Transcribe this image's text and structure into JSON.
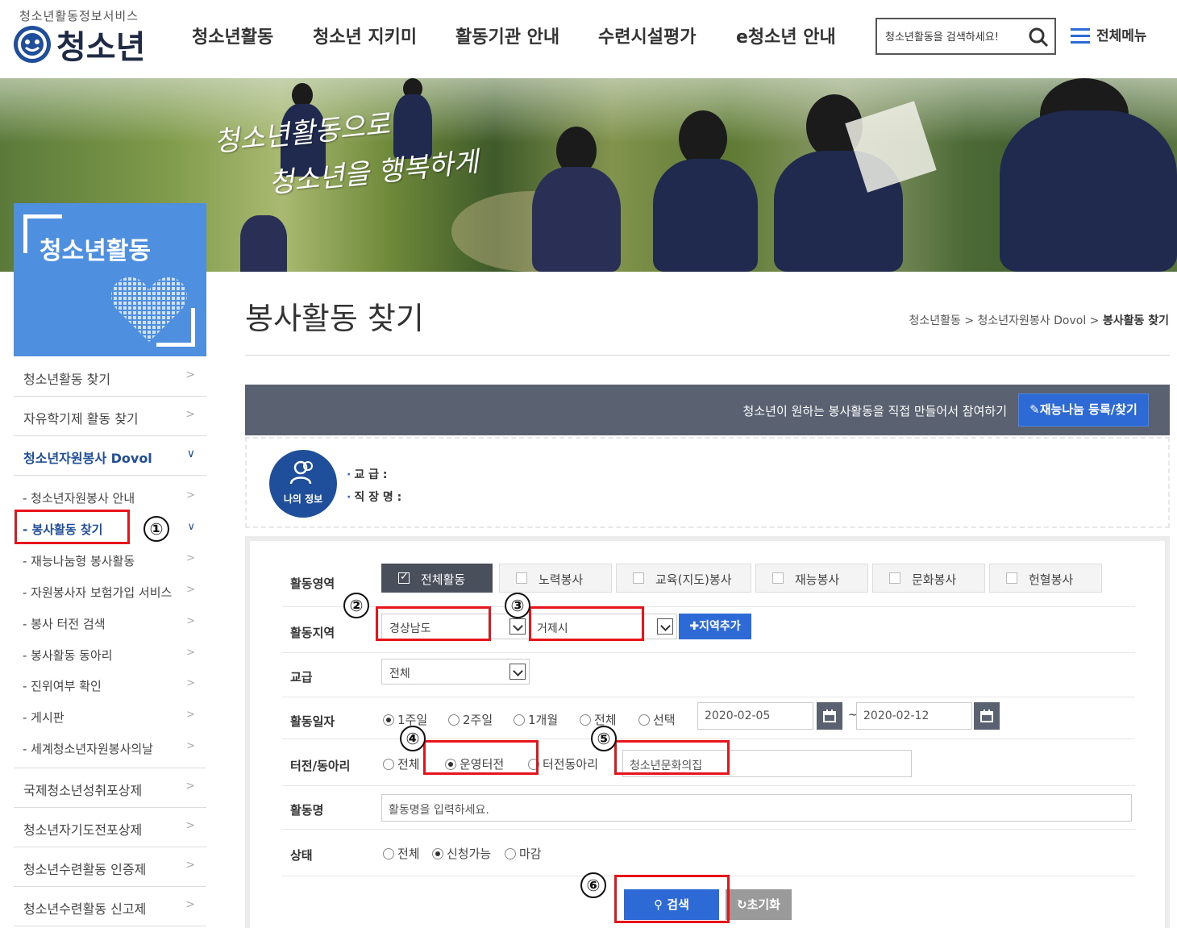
{
  "header": {
    "logo_sub": "청소년활동정보서비스",
    "logo_main": "청소년",
    "gnb": [
      "청소년활동",
      "청소년 지키미",
      "활동기관 안내",
      "수련시설평가",
      "e청소년 안내"
    ],
    "search_placeholder": "청소년활동을 검색하세요!",
    "all_menu": "전체메뉴"
  },
  "banner": {
    "line1": "청소년활동으로",
    "line2": "청소년을 행복하게"
  },
  "lnb": {
    "title": "청소년활동",
    "items": [
      {
        "label": "청소년활동 찾기"
      },
      {
        "label": "자유학기제 활동 찾기"
      },
      {
        "label": "청소년자원봉사 Dovol"
      }
    ],
    "subitems": [
      {
        "label": "- 청소년자원봉사 안내"
      },
      {
        "label": "- 봉사활동 찾기"
      },
      {
        "label": "- 재능나눔형 봉사활동"
      },
      {
        "label": "- 자원봉사자 보험가입 서비스"
      },
      {
        "label": "- 봉사 터전 검색"
      },
      {
        "label": "- 봉사활동 동아리"
      },
      {
        "label": "- 진위여부 확인"
      },
      {
        "label": "- 게시판"
      },
      {
        "label": "- 세계청소년자원봉사의날"
      }
    ],
    "bottom_items": [
      {
        "label": "국제청소년성취포상제"
      },
      {
        "label": "청소년자기도전포상제"
      },
      {
        "label": "청소년수련활동 인증제"
      },
      {
        "label": "청소년수련활동 신고제"
      }
    ]
  },
  "content": {
    "page_title": "봉사활동 찾기",
    "breadcrumb_1": "청소년활동 > 청소년자원봉사 Dovol > ",
    "breadcrumb_current": "봉사활동 찾기",
    "talent_text": "청소년이 원하는 봉사활동을 직접 만들어서 참여하기",
    "talent_button": "재능나눔 등록/찾기",
    "myinfo_label": "나의 정보",
    "myinfo_grade": "교  급   :",
    "myinfo_job": "직 장 명   :"
  },
  "form": {
    "labels": {
      "area": "활동영역",
      "region": "활동지역",
      "grade": "교급",
      "date": "활동일자",
      "club": "터전/동아리",
      "name": "활동명",
      "status": "상태"
    },
    "area_options": [
      "전체활동",
      "노력봉사",
      "교육(지도)봉사",
      "재능봉사",
      "문화봉사",
      "헌혈봉사"
    ],
    "region1": "경상남도",
    "region2": "거제시",
    "add_region": "지역추가",
    "grade_value": "전체",
    "date_options": [
      "1주일",
      "2주일",
      "1개월",
      "전체",
      "선택"
    ],
    "date_from": "2020-02-05",
    "date_sep": "~",
    "date_to": "2020-02-12",
    "club_options": [
      "전체",
      "운영터전",
      "터전동아리"
    ],
    "club_value": "청소년문화의집",
    "name_placeholder": "활동명을 입력하세요.",
    "status_options": [
      "전체",
      "신청가능",
      "마감"
    ],
    "search_button": "검색",
    "reset_button": "초기화"
  },
  "annotations": [
    "①",
    "②",
    "③",
    "④",
    "⑤",
    "⑥"
  ]
}
